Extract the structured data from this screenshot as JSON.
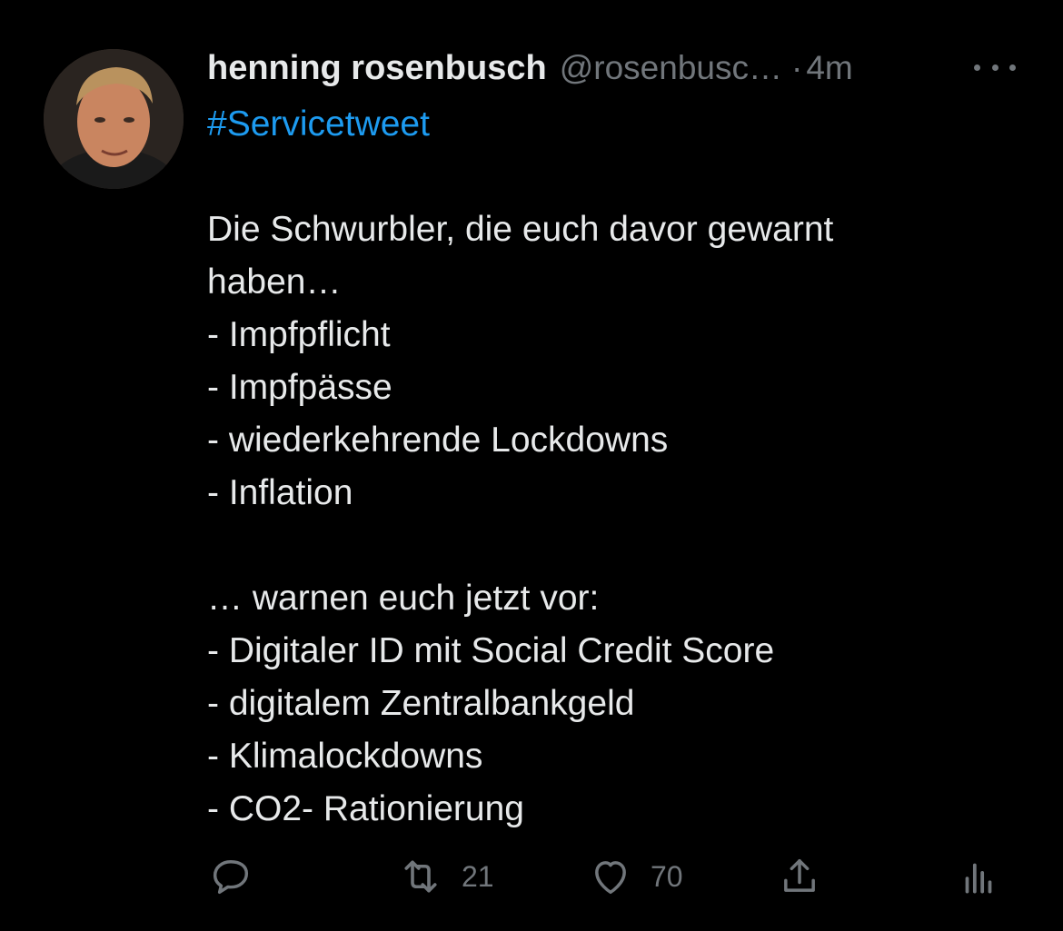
{
  "tweet": {
    "display_name": "henning rosenbusch",
    "handle": "@rosenbusc…",
    "separator": "·",
    "time": "4m",
    "hashtag": "#Servicetweet",
    "lines": [
      "Die Schwurbler, die euch davor gewarnt",
      "haben…",
      "- Impfpflicht",
      "- Impfpässe",
      "- wiederkehrende Lockdowns",
      "- Inflation",
      "",
      "… warnen euch jetzt vor:",
      "- Digitaler ID mit Social Credit Score",
      "- digitalem Zentralbankgeld",
      "- Klimalockdowns",
      "- CO2- Rationierung"
    ]
  },
  "actions": {
    "retweet_count": "21",
    "like_count": "70"
  },
  "icons": {
    "more": "more-horizontal-icon",
    "reply": "reply-icon",
    "retweet": "retweet-icon",
    "like": "heart-icon",
    "share": "share-icon",
    "analytics": "analytics-icon"
  },
  "colors": {
    "background": "#000000",
    "text": "#e7e9ea",
    "secondary": "#71767b",
    "hashtag": "#1d9bf0"
  }
}
